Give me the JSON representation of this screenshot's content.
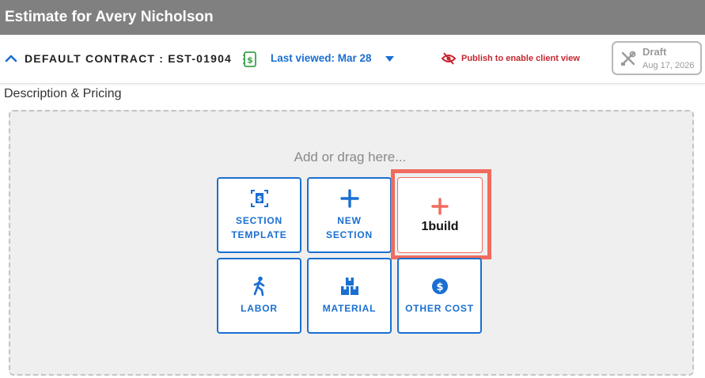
{
  "window": {
    "title": "Estimate for Avery Nicholson"
  },
  "header": {
    "contract_label": "DEFAULT CONTRACT : EST-01904",
    "last_viewed": "Last viewed: Mar 28",
    "publish_text": "Publish to enable client view",
    "draft": {
      "title": "Draft",
      "date": "Aug 17, 2026"
    }
  },
  "section": {
    "title": "Description & Pricing"
  },
  "dropzone": {
    "hint": "Add or drag here...",
    "tiles": [
      {
        "label": "SECTION TEMPLATE",
        "icon": "section-template-icon"
      },
      {
        "label": "NEW SECTION",
        "icon": "plus-icon"
      },
      {
        "label": "1build",
        "icon": "plus-icon",
        "highlighted": true
      },
      {
        "label": "LABOR",
        "icon": "walking-person-icon"
      },
      {
        "label": "MATERIAL",
        "icon": "boxes-icon"
      },
      {
        "label": "OTHER COST",
        "icon": "dollar-circle-icon"
      }
    ]
  },
  "colors": {
    "accent": "#1a6fd1",
    "danger": "#c6262e",
    "highlight": "#f06b5f",
    "titlebar": "#808080"
  }
}
